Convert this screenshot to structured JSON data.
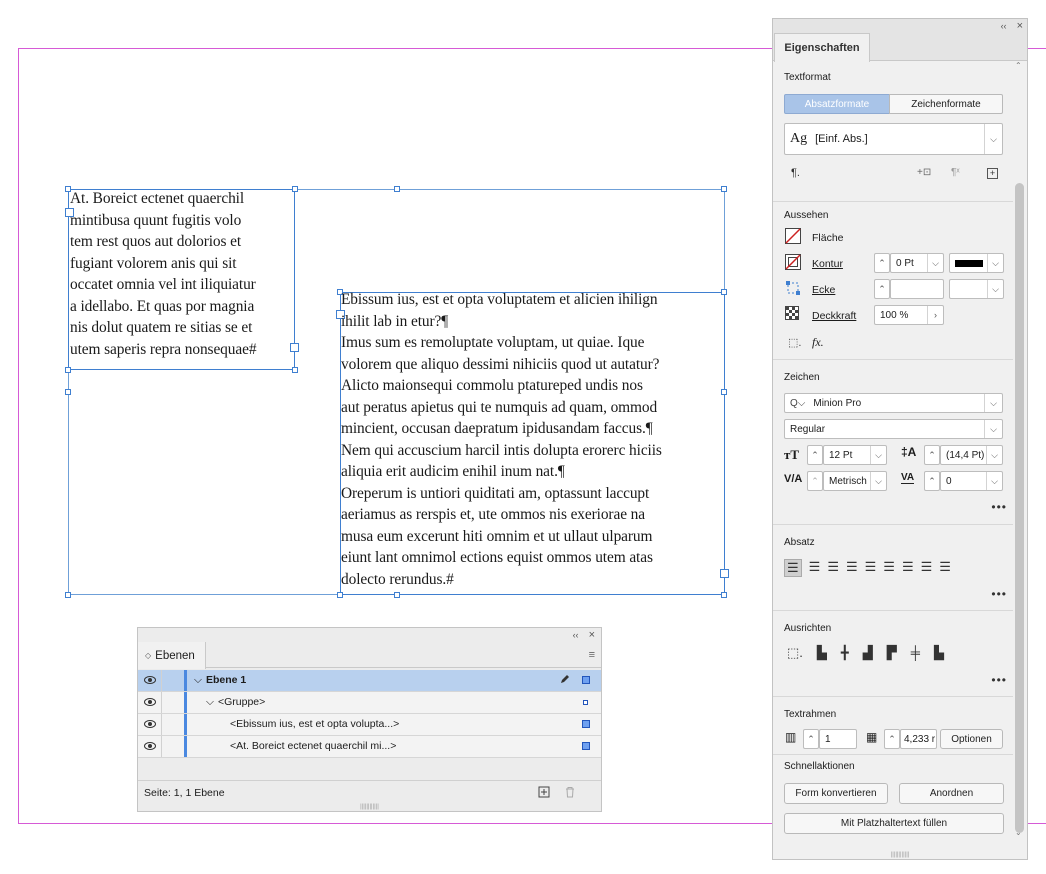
{
  "document": {
    "story_a": {
      "lines": [
        "At. Boreict ectenet quaerchil",
        "mintibusa quunt fugitis volo",
        "tem rest quos aut dolorios et",
        "fugiant volorem anis qui sit",
        "occatet omnia vel int iliquiatur",
        "a idellabo. Et quas por magnia",
        "nis dolut quatem re sitias se et",
        "utem saperis repra nonsequae#"
      ]
    },
    "story_b": {
      "lines": [
        "Ebissum ius, est et opta voluptatem et alicien ihilign",
        "ihilit lab in etur?¶",
        "Imus sum es remoluptate voluptam, ut quiae. Ique",
        "volorem que aliquo dessimi nihiciis quod ut autatur?",
        "Alicto maionsequi commolu ptatureped undis nos",
        "aut peratus apietus qui te numquis ad quam, ommod",
        "mincient, occusan daepratum ipidusandam faccus.¶",
        "Nem qui accuscium harcil intis dolupta erorerc hiciis",
        "aliquia erit audicim enihil inum nat.¶",
        "Oreperum is untiori quiditati am, optassunt laccupt",
        "aeriamus as rerspis et, ute ommos nis exeriorae na",
        "musa eum excerunt hiti omnim et ut ullaut ulparum",
        "eiunt lant omnimol ections equist ommos utem atas",
        "dolecto rerundus.#"
      ]
    }
  },
  "layers_panel": {
    "collapse_glyph": "‹‹",
    "close_glyph": "×",
    "tab_label": "Ebenen",
    "tab_arrow": "◇",
    "menu_glyph": "≡",
    "rows": [
      {
        "name": "Ebene 1",
        "expander": "⌵"
      },
      {
        "name": "<Gruppe>",
        "expander": "⌵"
      },
      {
        "name": "<Ebissum ius, est et opta volupta...>"
      },
      {
        "name": "<At. Boreict ectenet quaerchil mi...>"
      }
    ],
    "footer_status": "Seite: 1, 1 Ebene",
    "icons": {
      "eye": "eye-icon",
      "pen": "pen-icon",
      "new_layer": "new-layer-icon",
      "trash": "trash-icon"
    },
    "accent_color": "#4a88e0",
    "selected_row_color": "#b8d0ee"
  },
  "properties_panel": {
    "collapse_glyph": "‹‹",
    "close_glyph": "×",
    "tab_label": "Eigenschaften",
    "textformat": {
      "title": "Textformat",
      "seg_paragraph": "Absatzformate",
      "seg_character": "Zeichenformate",
      "style_prefix": "Ag",
      "style_value": "[Einf. Abs.]"
    },
    "aussehen": {
      "title": "Aussehen",
      "flaeche_label": "Fläche",
      "kontur_label": "Kontur",
      "kontur_value": "0 Pt",
      "ecke_label": "Ecke",
      "deckkraft_label": "Deckkraft",
      "deckkraft_value": "100 %",
      "fx_label": "fx."
    },
    "zeichen": {
      "title": "Zeichen",
      "font_family": "Minion Pro",
      "font_style": "Regular",
      "font_size": "12 Pt",
      "leading": "(14,4 Pt)",
      "kerning": "Metrisch",
      "tracking": "0"
    },
    "absatz": {
      "title": "Absatz"
    },
    "ausrichten": {
      "title": "Ausrichten"
    },
    "textrahmen": {
      "title": "Textrahmen",
      "columns": "1",
      "gutter": "4,233 r",
      "options_button": "Optionen"
    },
    "schnellaktionen": {
      "title": "Schnellaktionen",
      "convert_shape": "Form konvertieren",
      "arrange": "Anordnen",
      "fill_placeholder": "Mit Platzhaltertext füllen"
    },
    "more_glyph": "•••",
    "active_segment_color": "#a9c4e8",
    "stroke_color": "#000000",
    "no_fill_color": "#cc2222"
  },
  "canvas": {
    "page_border_color": "#d65ad6",
    "frame_color": "#3f7fd0"
  }
}
